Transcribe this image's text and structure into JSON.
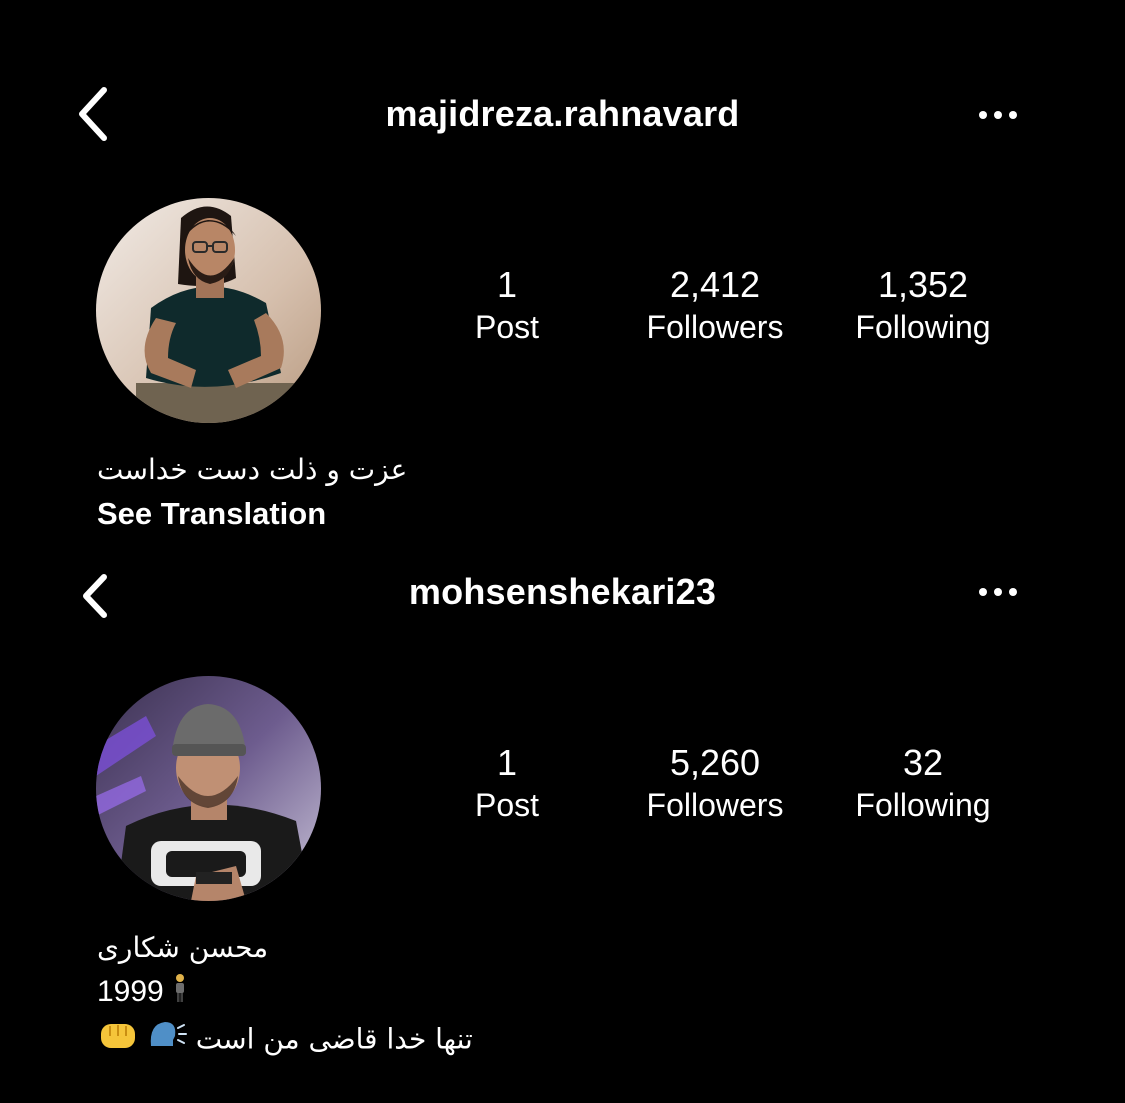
{
  "profiles": [
    {
      "username": "majidreza.rahnavard",
      "stats": {
        "posts": {
          "value": "1",
          "label": "Post"
        },
        "followers": {
          "value": "2,412",
          "label": "Followers"
        },
        "following": {
          "value": "1,352",
          "label": "Following"
        }
      },
      "bio": [
        "عزت و ذلت دست خداست"
      ],
      "see_translation": "See Translation"
    },
    {
      "username": "mohsenshekari23",
      "stats": {
        "posts": {
          "value": "1",
          "label": "Post"
        },
        "followers": {
          "value": "5,260",
          "label": "Followers"
        },
        "following": {
          "value": "32",
          "label": "Following"
        }
      },
      "bio": [
        "محسن شکاری",
        "1999",
        "تنها خدا قاضی من است"
      ],
      "bio_emojis": [
        "man-standing-emoji",
        "speaking-head-emoji",
        "fist-emoji"
      ]
    }
  ],
  "icons": {
    "back": "chevron-left-icon",
    "more": "ellipsis-icon"
  },
  "colors": {
    "background": "#000000",
    "text": "#ffffff"
  }
}
